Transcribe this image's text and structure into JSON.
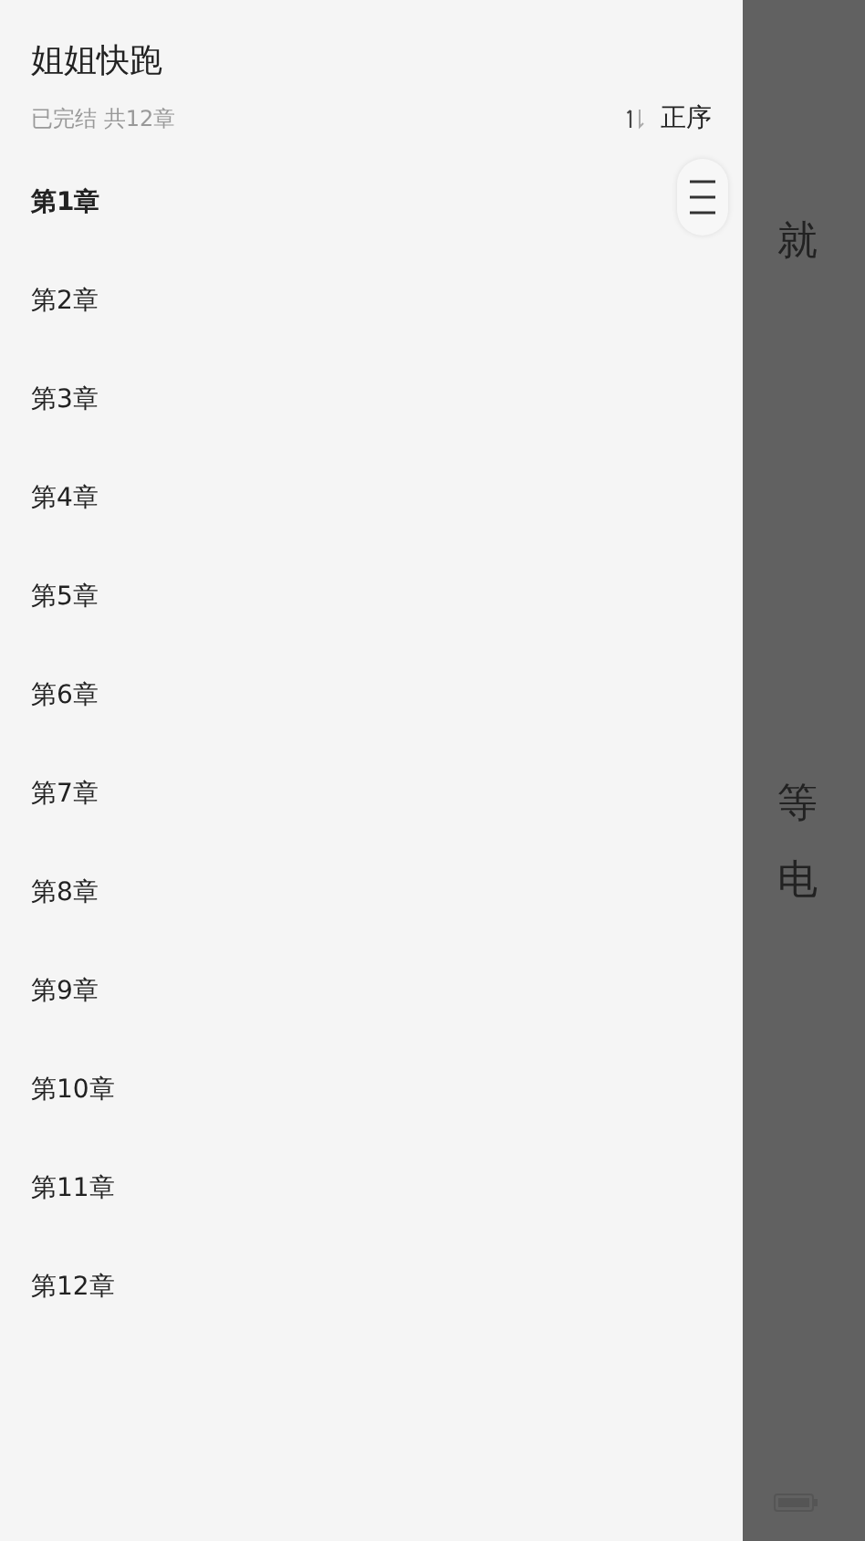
{
  "book": {
    "title": "姐姐快跑",
    "status": "已完结 共12章",
    "sort_label": "正序"
  },
  "chapters": [
    {
      "title": "第1章",
      "selected": true
    },
    {
      "title": "第2章",
      "selected": false
    },
    {
      "title": "第3章",
      "selected": false
    },
    {
      "title": "第4章",
      "selected": false
    },
    {
      "title": "第5章",
      "selected": false
    },
    {
      "title": "第6章",
      "selected": false
    },
    {
      "title": "第7章",
      "selected": false
    },
    {
      "title": "第8章",
      "selected": false
    },
    {
      "title": "第9章",
      "selected": false
    },
    {
      "title": "第10章",
      "selected": false
    },
    {
      "title": "第11章",
      "selected": false
    },
    {
      "title": "第12章",
      "selected": false
    }
  ],
  "background_text": [
    "就",
    "等",
    "电"
  ]
}
